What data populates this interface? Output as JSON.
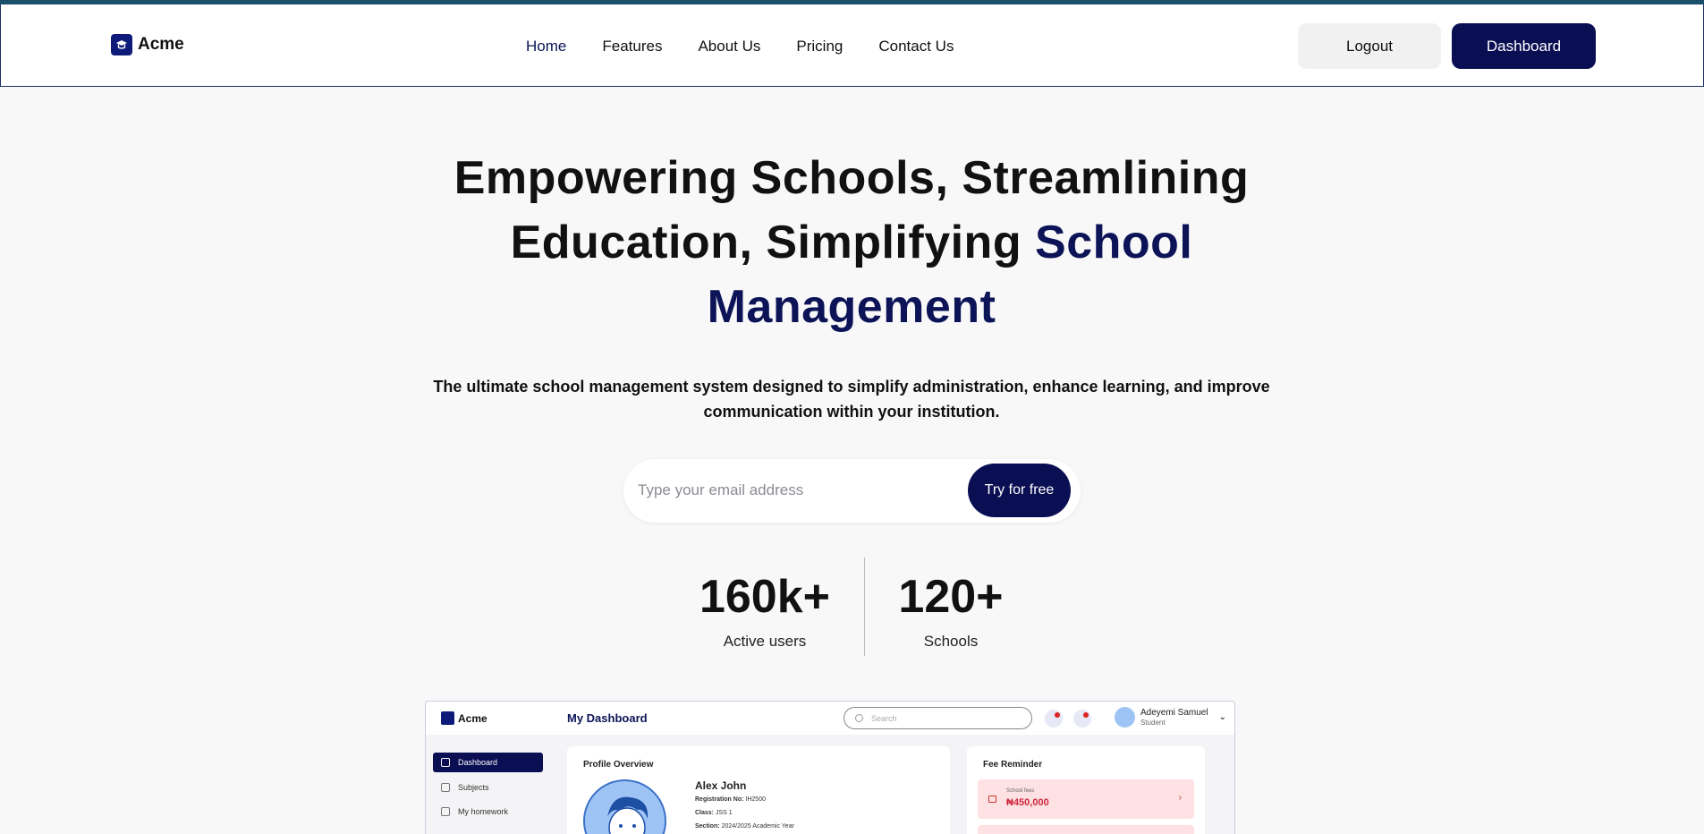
{
  "brand": {
    "name": "Acme",
    "accent": "#0a0f54",
    "stripe": "#1c4f6a"
  },
  "nav": {
    "links": [
      {
        "label": "Home",
        "active": true
      },
      {
        "label": "Features"
      },
      {
        "label": "About Us"
      },
      {
        "label": "Pricing"
      },
      {
        "label": "Contact Us"
      }
    ],
    "logout_label": "Logout",
    "dashboard_label": "Dashboard"
  },
  "hero": {
    "title_line1": "Empowering Schools, Streamlining",
    "title_line2": "Education, Simplifying ",
    "title_highlight_1": "School",
    "title_highlight_2": "Management",
    "subtitle": "The ultimate school management system designed to simplify administration, enhance learning, and improve communication within your institution."
  },
  "signup": {
    "email_placeholder": "Type your email address",
    "button_label": "Try for free"
  },
  "stats": [
    {
      "value": "160k+",
      "label": "Active users"
    },
    {
      "value": "120+",
      "label": "Schools"
    }
  ],
  "preview": {
    "brand": "Acme",
    "title": "My Dashboard",
    "search_placeholder": "Search",
    "user": {
      "name": "Adeyemi Samuel",
      "role": "Student"
    },
    "sidebar": [
      {
        "label": "Dashboard",
        "active": true
      },
      {
        "label": "Subjects"
      },
      {
        "label": "My homework"
      }
    ],
    "profile": {
      "heading": "Profile Overview",
      "name": "Alex John",
      "registration_label": "Registration No:",
      "registration_value": "IH2500",
      "class_label": "Class:",
      "class_value": "JSS 1",
      "section_label": "Section:",
      "section_value": "2024/2025 Academic Year"
    },
    "fee": {
      "heading": "Fee Reminder",
      "item_label": "School fees",
      "item_amount": "₦450,000"
    }
  }
}
